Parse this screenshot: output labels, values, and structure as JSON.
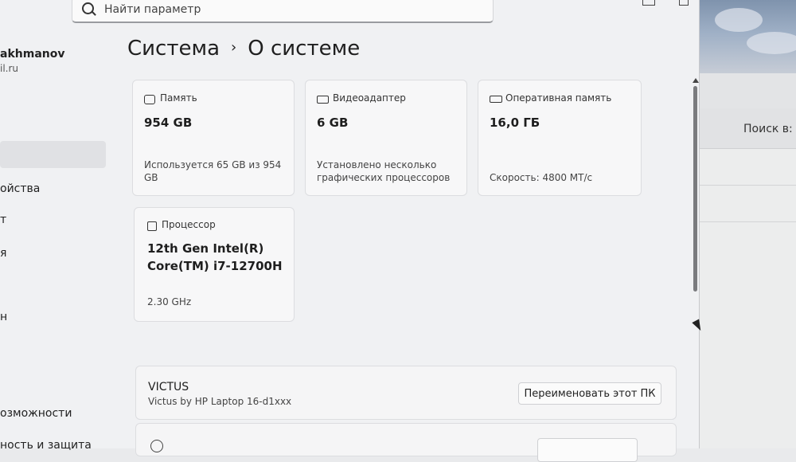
{
  "search": {
    "placeholder": "Найти параметр"
  },
  "user": {
    "name": "akhmanov",
    "email": "il.ru"
  },
  "sidebar": {
    "items": [
      {
        "label": "ойства"
      },
      {
        "label": "т"
      },
      {
        "label": "я"
      },
      {
        "label": "н"
      },
      {
        "label": "озможности"
      },
      {
        "label": "ность и защита"
      }
    ]
  },
  "breadcrumb": {
    "parent": "Система",
    "separator": "›",
    "current": "О системе"
  },
  "specs": {
    "storage": {
      "label": "Память",
      "icon": "storage-icon",
      "value": "954 GB",
      "detail": "Используется 65 GB из 954 GB"
    },
    "gpu": {
      "label": "Видеоадаптер",
      "icon": "gpu-icon",
      "value": "6 GB",
      "detail_line1": "Установлено несколько",
      "detail_line2": "графических процессоров"
    },
    "ram": {
      "label": "Оперативная память",
      "icon": "ram-icon",
      "value": "16,0 ГБ",
      "detail": "Скорость: 4800 МТ/с"
    },
    "cpu": {
      "label": "Процессор",
      "icon": "cpu-icon",
      "value_line1": "12th Gen Intel(R)",
      "value_line2": "Core(TM) i7-12700H",
      "detail": "2.30 GHz"
    }
  },
  "device": {
    "name": "VICTUS",
    "model": "Victus by HP Laptop 16-d1xxx",
    "rename_label": "Переименовать этот ПК"
  },
  "background_window": {
    "search_label": "Поиск в: Э"
  }
}
